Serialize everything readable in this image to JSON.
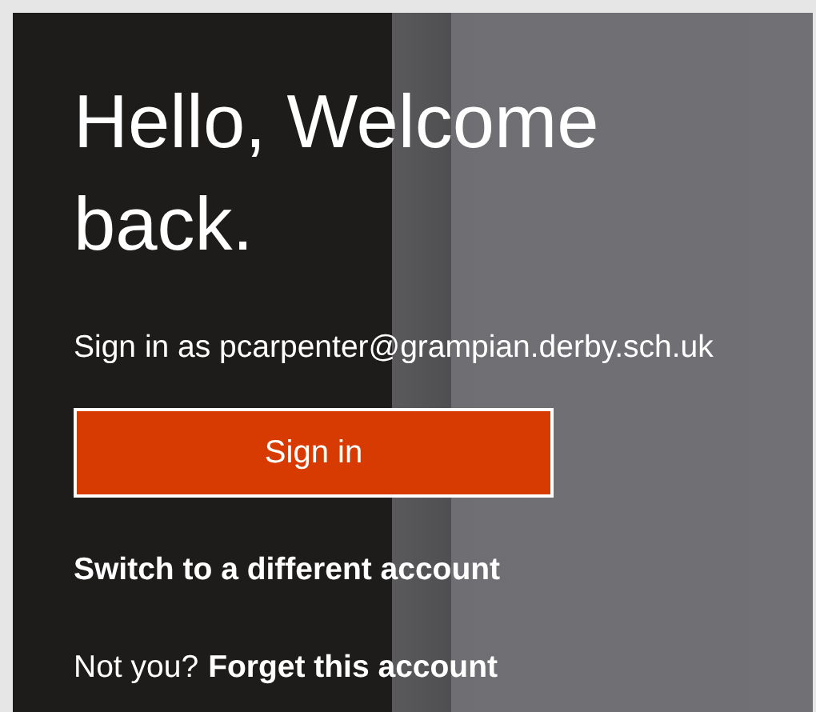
{
  "heading": "Hello, Welcome back.",
  "account_prompt": "Sign in as pcarpenter@grampian.derby.sch.uk",
  "sign_in_button": "Sign in",
  "switch_account_link": "Switch to a different account",
  "forget_prompt": "Not you?",
  "forget_account_link": "Forget this account"
}
